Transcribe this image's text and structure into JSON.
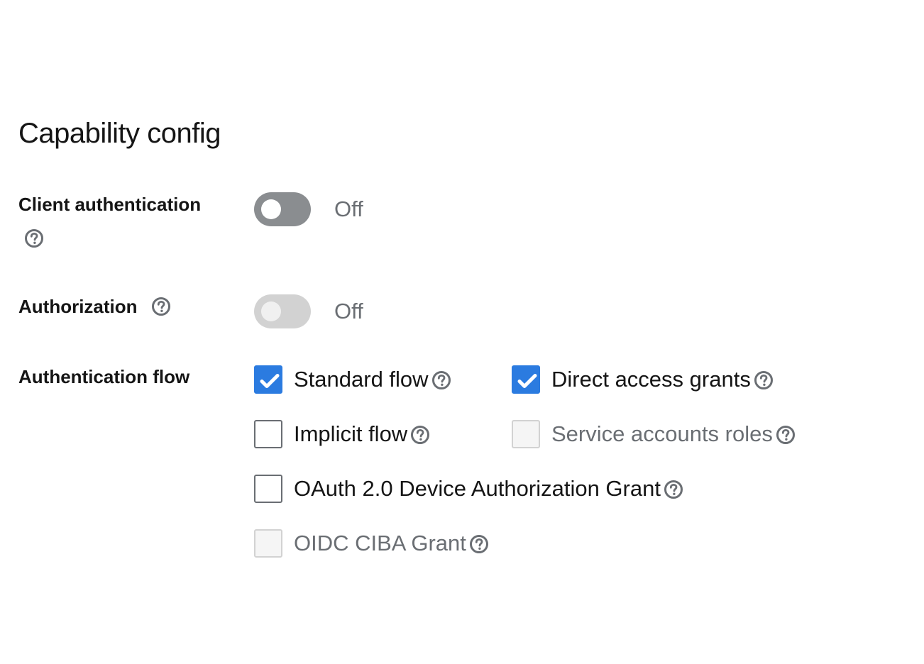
{
  "section": {
    "title": "Capability config"
  },
  "client_authentication": {
    "label": "Client authentication",
    "state_text": "Off",
    "enabled": false
  },
  "authorization": {
    "label": "Authorization",
    "state_text": "Off",
    "enabled": false,
    "disabled": true
  },
  "authentication_flow": {
    "label": "Authentication flow",
    "options": [
      {
        "label": "Standard flow",
        "checked": true,
        "disabled": false
      },
      {
        "label": "Direct access grants",
        "checked": true,
        "disabled": false
      },
      {
        "label": "Implicit flow",
        "checked": false,
        "disabled": false
      },
      {
        "label": "Service accounts roles",
        "checked": false,
        "disabled": true
      },
      {
        "label": "OAuth 2.0 Device Authorization Grant",
        "checked": false,
        "disabled": false
      },
      {
        "label": "OIDC CIBA Grant",
        "checked": false,
        "disabled": true
      }
    ]
  },
  "colors": {
    "accent": "#2b7be0",
    "help_icon": "#6a6e73",
    "switch_off": "#8a8d90",
    "switch_disabled": "#d2d2d2"
  },
  "icons": {
    "help": "question-circle-icon",
    "check": "checkmark-icon"
  }
}
